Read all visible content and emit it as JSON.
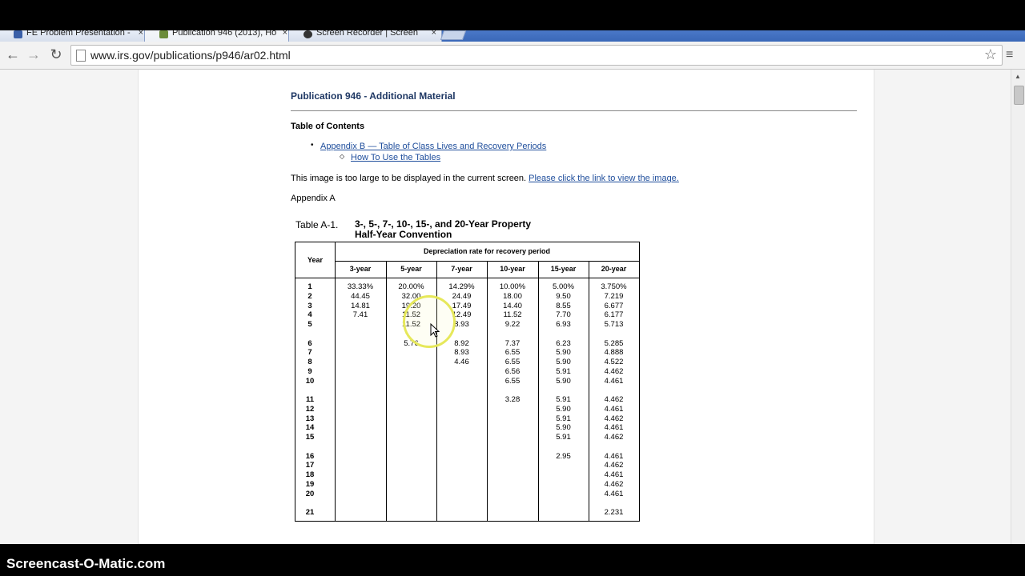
{
  "tabs": [
    {
      "title": "FE Problem Presentation -",
      "close": "×"
    },
    {
      "title": "Publication 946 (2013), Ho",
      "close": "×"
    },
    {
      "title": "Screen Recorder | Screen",
      "close": "×"
    }
  ],
  "toolbar": {
    "back": "←",
    "forward": "→",
    "reload": "↻",
    "url": "www.irs.gov/publications/p946/ar02.html",
    "star": "☆",
    "menu": "≡"
  },
  "page": {
    "title": "Publication 946 - Additional Material",
    "toc_heading": "Table of Contents",
    "toc_link1": "Appendix B — Table of Class Lives and Recovery Periods",
    "toc_link2": "How To Use the Tables",
    "notice_text": "This image is too large to be displayed in the current screen. ",
    "notice_link": "Please click the link to view the image.",
    "appendix": "Appendix A"
  },
  "table": {
    "label": "Table A-1.",
    "title_line1": "3-, 5-, 7-, 10-, 15-, and 20-Year Property",
    "title_line2": "Half-Year Convention",
    "year_header": "Year",
    "group_header": "Depreciation rate for recovery period",
    "columns": [
      "3-year",
      "5-year",
      "7-year",
      "10-year",
      "15-year",
      "20-year"
    ],
    "years": "1\n2\n3\n4\n5\n\n6\n7\n8\n9\n10\n\n11\n12\n13\n14\n15\n\n16\n17\n18\n19\n20\n\n21",
    "col_3": "33.33%\n44.45\n14.81\n7.41",
    "col_5": "20.00%\n32.00\n19.20\n11.52\n11.52\n\n5.76",
    "col_7": "14.29%\n24.49\n17.49\n12.49\n8.93\n\n8.92\n8.93\n4.46",
    "col_10": "10.00%\n18.00\n14.40\n11.52\n9.22\n\n7.37\n6.55\n6.55\n6.56\n6.55\n\n3.28",
    "col_15": "5.00%\n9.50\n8.55\n7.70\n6.93\n\n6.23\n5.90\n5.90\n5.91\n5.90\n\n5.91\n5.90\n5.91\n5.90\n5.91\n\n2.95",
    "col_20": "3.750%\n7.219\n6.677\n6.177\n5.713\n\n5.285\n4.888\n4.522\n4.462\n4.461\n\n4.462\n4.461\n4.462\n4.461\n4.462\n\n4.461\n4.462\n4.461\n4.462\n4.461\n\n2.231"
  },
  "watermark": "Screencast-O-Matic.com"
}
